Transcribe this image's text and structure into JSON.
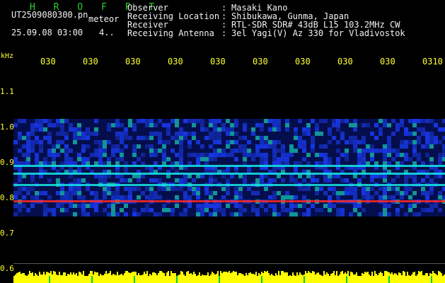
{
  "header": {
    "brand": "H R O F F T",
    "file_name": "UT2509080300.pn",
    "file_suffix": "meteor",
    "date_time": "25.09.08 03:00",
    "count": "4.."
  },
  "meta": [
    {
      "label": "Observer",
      "value": "Masaki Kano"
    },
    {
      "label": "Receiving Location",
      "value": "Shibukawa, Gunma, Japan"
    },
    {
      "label": "Receiver",
      "value": "RTL-SDR SDR# 43dB L15 103.2MHz CW"
    },
    {
      "label": "Receiving Antenna",
      "value": "3el Yagi(V) Az 330 for Vladivostok"
    }
  ],
  "axes": {
    "y_unit": "kHz",
    "y_ticks": [
      "1.1",
      "1.0",
      "0.9",
      "0.8",
      "0.7",
      "0.6"
    ],
    "x_ticks": [
      "030",
      "030",
      "030",
      "030",
      "030",
      "030",
      "030",
      "030",
      "030",
      "0310"
    ]
  },
  "colors": {
    "background": "#000000",
    "axis_text": "#ffff33",
    "brand": "#2ad12a",
    "noise_blue": "#1a3cff",
    "signal_cyan": "#19e6e6",
    "signal_red": "#ff2a2a",
    "power_yellow": "#ffff00"
  }
}
